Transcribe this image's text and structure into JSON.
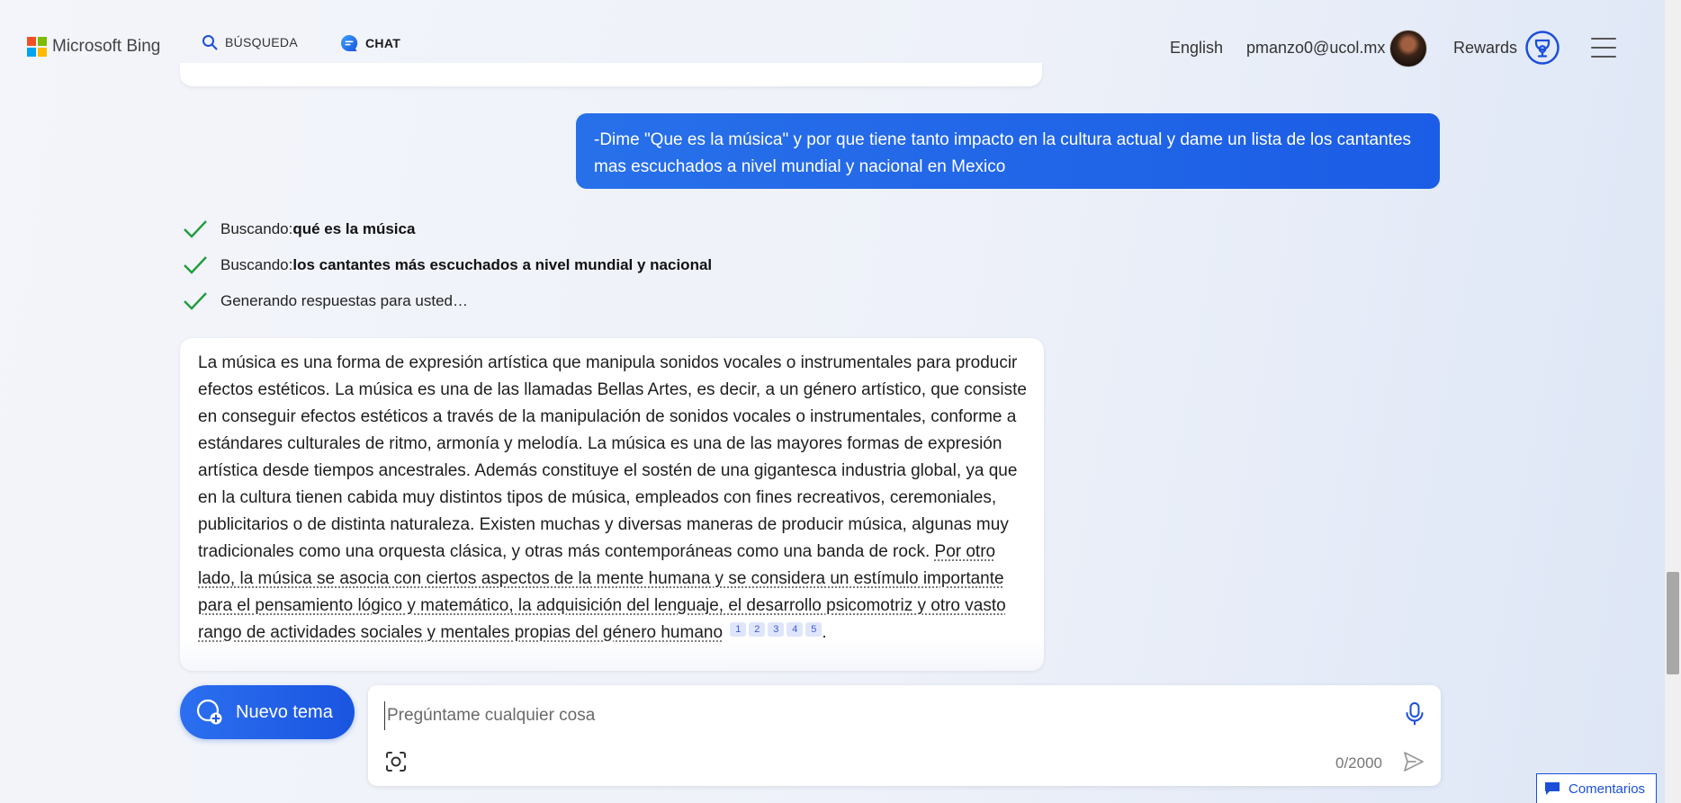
{
  "header": {
    "brand": "Microsoft Bing",
    "tabs": [
      {
        "label": "BÚSQUEDA",
        "icon": "search-icon",
        "active": false
      },
      {
        "label": "CHAT",
        "icon": "chat-icon",
        "active": true
      }
    ],
    "language": "English",
    "user_email": "pmanzo0@ucol.mx",
    "rewards_label": "Rewards"
  },
  "conversation": {
    "user_message": "-Dime \"Que es la música\" y por que tiene tanto impacto en la cultura actual y dame un lista de los cantantes mas escuchados a nivel mundial y nacional en Mexico",
    "steps": [
      {
        "prefix": "Buscando: ",
        "query": "qué es la música"
      },
      {
        "prefix": "Buscando: ",
        "query": "los cantantes más escuchados a nivel mundial y nacional"
      },
      {
        "prefix": "Generando respuestas para usted…",
        "query": ""
      }
    ],
    "answer": {
      "plain": "La música es una forma de expresión artística que manipula sonidos vocales o instrumentales para producir efectos estéticos. La música es una de las llamadas Bellas Artes, es decir, a un género artístico, que consiste en conseguir efectos estéticos a través de la manipulación de sonidos vocales o instrumentales, conforme a estándares culturales de ritmo, armonía y melodía. La música es una de las mayores formas de expresión artística desde tiempos ancestrales. Además constituye el sostén de una gigantesca industria global, ya que en la cultura tienen cabida muy distintos tipos de música, empleados con fines recreativos, ceremoniales, publicitarios o de distinta naturaleza. Existen muchas y diversas maneras de producir música, algunas muy tradicionales como una orquesta clásica, y otras más contemporáneas como una banda de rock. ",
      "cited": "Por otro lado, la música se asocia con ciertos aspectos de la mente humana y se considera un estímulo importante para el pensamiento lógico y matemático, la adquisición del lenguaje, el desarrollo psicomotriz y otro vasto rango de actividades sociales y mentales propias del género humano",
      "citations": [
        "1",
        "2",
        "3",
        "4",
        "5"
      ],
      "end": "."
    }
  },
  "composer": {
    "new_topic_label": "Nuevo tema",
    "placeholder": "Pregúntame cualquier cosa",
    "value": "",
    "char_count": "0/2000"
  },
  "feedback_label": "Comentarios",
  "colors": {
    "accent": "#1b5de6",
    "check": "#1f9d3a",
    "citation_bg": "#dfe6fb"
  }
}
